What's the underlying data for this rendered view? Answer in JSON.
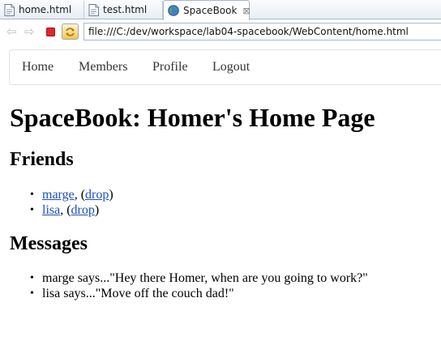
{
  "tabs": [
    {
      "label": "home.html",
      "icon": "html-file-icon",
      "active": false
    },
    {
      "label": "test.html",
      "icon": "html-file-icon",
      "active": false
    },
    {
      "label": "SpaceBook",
      "icon": "globe-icon",
      "active": true,
      "close": "⊠"
    }
  ],
  "toolbar": {
    "back_glyph": "⇦",
    "forward_glyph": "⇨",
    "url": "file:///C:/dev/workspace/lab04-spacebook/WebContent/home.html"
  },
  "menu": {
    "items": [
      "Home",
      "Members",
      "Profile",
      "Logout"
    ]
  },
  "page": {
    "title": "SpaceBook: Homer's Home Page",
    "friends_heading": "Friends",
    "friends": [
      {
        "name": "marge",
        "sep": ", (",
        "action": "drop",
        "end": ")"
      },
      {
        "name": "lisa",
        "sep": ", (",
        "action": "drop",
        "end": ")"
      }
    ],
    "messages_heading": "Messages",
    "messages": [
      "marge says...\"Hey there Homer, when are you going to work?\"",
      "lisa says...\"Move off the couch dad!\""
    ],
    "bullet": "•"
  },
  "colors": {
    "link": "#1a4fbf",
    "stop_button": "#e2262b",
    "tab_strip": "#e8edf5"
  }
}
